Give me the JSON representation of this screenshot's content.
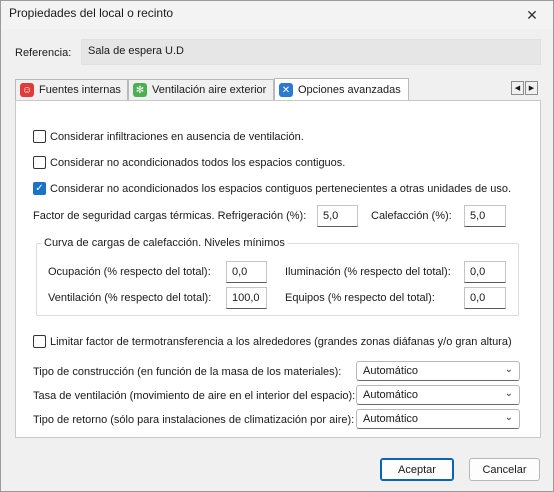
{
  "window": {
    "title": "Propiedades del local o recinto",
    "close_glyph": "✕"
  },
  "reference": {
    "label": "Referencia:",
    "value": "Sala de espera U.D"
  },
  "tabs": [
    {
      "label": "Fuentes internas",
      "icon": "people-icon",
      "color": "#e03b3b"
    },
    {
      "label": "Ventilación aire exterior",
      "icon": "fan-icon",
      "color": "#4caf50"
    },
    {
      "label": "Opciones avanzadas",
      "icon": "tools-icon",
      "color": "#2b79d0"
    }
  ],
  "options": {
    "infiltraciones": {
      "label": "Considerar infiltraciones en ausencia de ventilación.",
      "checked": false
    },
    "no_acond_todos": {
      "label": "Considerar no acondicionados todos los espacios contiguos.",
      "checked": false
    },
    "no_acond_otras": {
      "label": "Considerar no acondicionados los espacios contiguos pertenecientes a otras unidades de uso.",
      "checked": true
    }
  },
  "security": {
    "label": "Factor de seguridad cargas térmicas. Refrigeración (%):",
    "refrigeracion": "5,0",
    "calefaccion_label": "Calefacción (%):",
    "calefaccion": "5,0"
  },
  "curve": {
    "title": "Curva de cargas de calefacción. Niveles mínimos",
    "ocupacion_label": "Ocupación (% respecto del total):",
    "ocupacion": "0,0",
    "iluminacion_label": "Iluminación (% respecto del total):",
    "iluminacion": "0,0",
    "ventilacion_label": "Ventilación (% respecto del total):",
    "ventilacion": "100,0",
    "equipos_label": "Equipos (% respecto del total):",
    "equipos": "0,0"
  },
  "limit": {
    "label": "Limitar factor de termotransferencia a los alrededores (grandes zonas diáfanas y/o gran altura)",
    "checked": false
  },
  "selects": {
    "construccion": {
      "label": "Tipo de construcción (en función de la masa de los materiales):",
      "value": "Automático"
    },
    "ventilacion": {
      "label": "Tasa de ventilación (movimiento de aire en el interior del espacio):",
      "value": "Automático"
    },
    "retorno": {
      "label": "Tipo de retorno (sólo para instalaciones de climatización por aire):",
      "value": "Automático"
    }
  },
  "buttons": {
    "accept": "Aceptar",
    "cancel": "Cancelar"
  },
  "tab_scroll": {
    "left": "◀",
    "right": "▶"
  }
}
